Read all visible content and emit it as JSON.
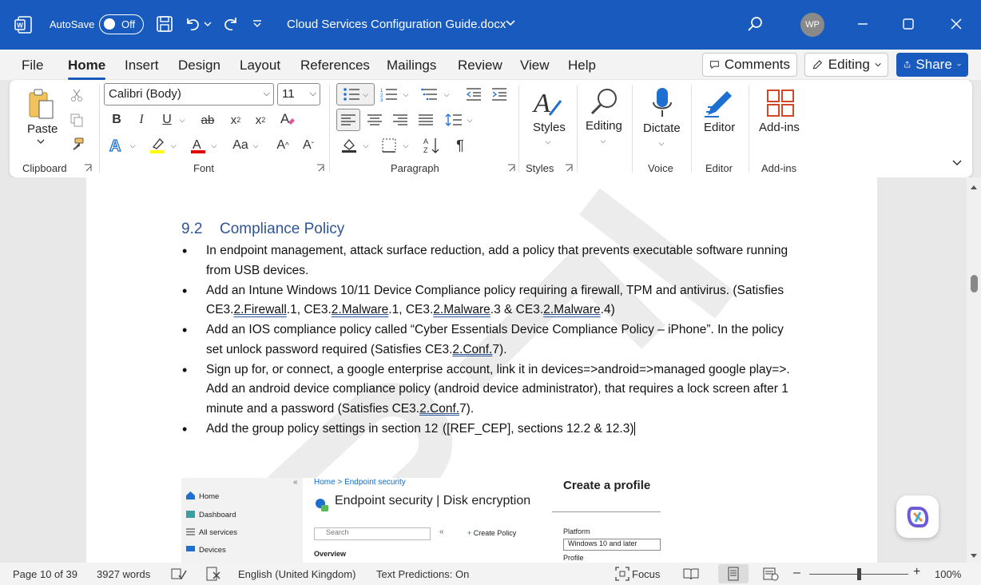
{
  "titlebar": {
    "autosave_label": "AutoSave",
    "autosave_state": "Off",
    "document_title": "Cloud Services Configuration Guide.docx",
    "user_initials": "WP"
  },
  "menu": {
    "tabs": [
      "File",
      "Home",
      "Insert",
      "Design",
      "Layout",
      "References",
      "Mailings",
      "Review",
      "View",
      "Help"
    ],
    "active_tab": "Home",
    "comments_label": "Comments",
    "editing_label": "Editing",
    "share_label": "Share"
  },
  "ribbon": {
    "font_name": "Calibri (Body)",
    "font_size": "11",
    "paste_label": "Paste",
    "styles_label": "Styles",
    "editing_label": "Editing",
    "dictate_label": "Dictate",
    "editor_label": "Editor",
    "addins_label": "Add-ins",
    "groups": {
      "clipboard": "Clipboard",
      "font": "Font",
      "paragraph": "Paragraph",
      "styles": "Styles",
      "voice": "Voice",
      "editor": "Editor",
      "addins": "Add-ins"
    }
  },
  "document": {
    "heading_number": "9.2",
    "heading_text": "Compliance Policy",
    "bullets": {
      "b1": "In endpoint management, attack surface reduction, add a policy that prevents executable software running from USB devices.",
      "b2_a": "Add an Intune Windows 10/11 Device Compliance policy requiring a firewall, TPM and antivirus. (Satisfies CE3.",
      "b2_u1": "2.Firewall",
      "b2_b": ".1, CE3.",
      "b2_u2": "2.Malware",
      "b2_c": ".1, CE3.",
      "b2_u3": "2.Malware",
      "b2_d": ".3 & CE3.",
      "b2_u4": "2.Malware",
      "b2_e": ".4)",
      "b3_a": "Add an IOS compliance policy called “Cyber Essentials Device Compliance Policy – iPhone”. In the policy set unlock password required (Satisfies CE3.",
      "b3_u": "2.Conf.",
      "b3_b": "7).",
      "b4_a": "Sign up for, or connect, a google enterprise account, link it in devices=>android=>managed google play=>. Add an android device compliance policy (android device administrator), that requires a lock screen after 1 minute and a password (Satisfies CE3.",
      "b4_u": "2.Conf.",
      "b4_b": "7).",
      "b5_a": "Add the group policy settings in section 12 ",
      "b5_b": "([REF_CEP], sections 12.2 & 12.3)"
    },
    "screenshot": {
      "nav": [
        "Home",
        "Dashboard",
        "All services",
        "Devices"
      ],
      "breadcrumb": "Home > Endpoint security",
      "title": "Endpoint security | Disk encryption",
      "search_placeholder": "Search",
      "create_policy": "Create Policy",
      "overview": "Overview",
      "panel_title": "Create a profile",
      "platform_label": "Platform",
      "platform_value": "Windows 10 and later",
      "profile_label": "Profile"
    }
  },
  "status": {
    "page": "Page 10 of 39",
    "words": "3927 words",
    "language": "English (United Kingdom)",
    "predictions": "Text Predictions: On",
    "focus": "Focus",
    "zoom": "100%",
    "zoom_level": 1.0
  }
}
